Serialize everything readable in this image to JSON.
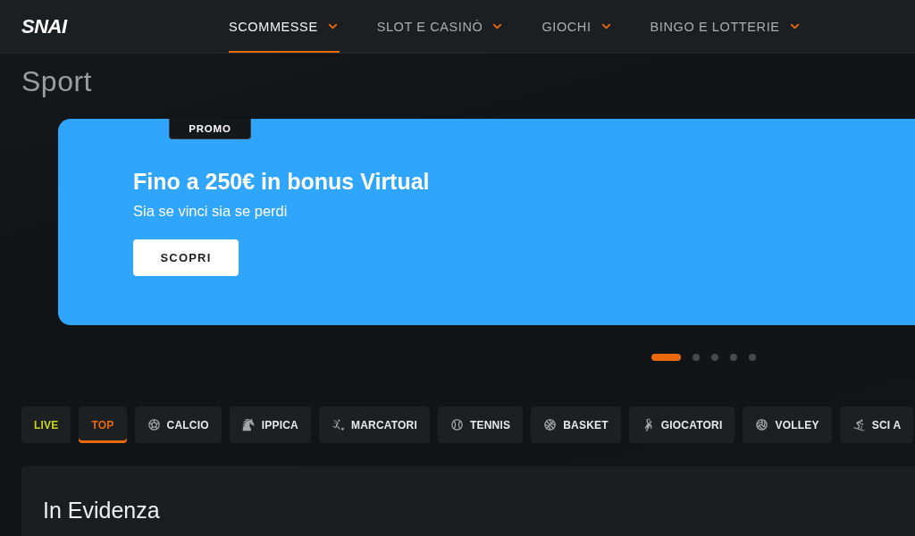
{
  "header": {
    "logo": "SNAI",
    "nav": [
      {
        "label": "SCOMMESSE",
        "selected": true
      },
      {
        "label": "SLOT E CASINÒ",
        "selected": false
      },
      {
        "label": "GIOCHI",
        "selected": false
      },
      {
        "label": "BINGO E LOTTERIE",
        "selected": false
      }
    ]
  },
  "page_title": "Sport",
  "promo_banner": {
    "badge": "PROMO",
    "title": "Fino a 250€ in bonus Virtual",
    "subtitle": "Sia se vinci sia se perdi",
    "button": "SCOPRI"
  },
  "carousel_dots": [
    {
      "selected": true
    },
    {
      "selected": false
    },
    {
      "selected": false
    },
    {
      "selected": false
    },
    {
      "selected": false
    }
  ],
  "sport_tabs": [
    {
      "label": "LIVE",
      "kind": "live",
      "selected": false
    },
    {
      "label": "TOP",
      "kind": "plain",
      "selected": true
    },
    {
      "label": "CALCIO",
      "kind": "sport",
      "selected": false
    },
    {
      "label": "IPPICA",
      "kind": "sport",
      "selected": false
    },
    {
      "label": "MARCATORI",
      "kind": "sport",
      "selected": false
    },
    {
      "label": "TENNIS",
      "kind": "sport",
      "selected": false
    },
    {
      "label": "BASKET",
      "kind": "sport",
      "selected": false
    },
    {
      "label": "GIOCATORI",
      "kind": "sport",
      "selected": false
    },
    {
      "label": "VOLLEY",
      "kind": "sport",
      "selected": false
    },
    {
      "label": "SCI A",
      "kind": "sport",
      "selected": false
    }
  ],
  "featured": {
    "title": "In Evidenza"
  }
}
